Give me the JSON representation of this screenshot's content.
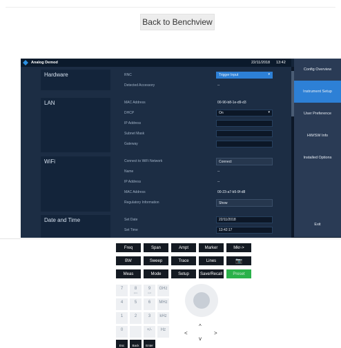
{
  "header": {
    "back_label": "Back to Benchview"
  },
  "titlebar": {
    "app": "Analog Demod",
    "date": "22/11/2018",
    "time": "13:42"
  },
  "sections": {
    "hardware": "Hardware",
    "lan": "LAN",
    "wifi": "WiFi",
    "datetime": "Date and Time"
  },
  "hardware": {
    "rnc_label": "RNC",
    "rnc_value": "Trigger Input",
    "accessory_label": "Detected Accessory",
    "accessory_value": "--"
  },
  "lan": {
    "mac_label": "MAC Address",
    "mac_value": "00-90-b8-1e-d9-d3",
    "dhcp_label": "DHCP",
    "dhcp_value": "On",
    "ip_label": "IP Address",
    "subnet_label": "Subnet Mask",
    "gateway_label": "Gateway"
  },
  "wifi": {
    "connect_label": "Connect to WiFi Network",
    "connect_button": "Connect",
    "name_label": "Name",
    "name_value": "--",
    "ip_label": "IP Address",
    "ip_value": "--",
    "mac_label": "MAC Address",
    "mac_value": "00-23-a7-b5-9f-d8",
    "regulatory_label": "Regulatory Information",
    "regulatory_button": "Show"
  },
  "datetime": {
    "date_label": "Set Date",
    "date_value": "22/11/2018",
    "time_label": "Set Time",
    "time_value": "13:42:17"
  },
  "softkeys": [
    {
      "label": "Config Overview"
    },
    {
      "label": "Instrument Setup"
    },
    {
      "label": "User Preference"
    },
    {
      "label": "HW/SW Info"
    },
    {
      "label": "Installed Options"
    },
    {
      "label": ""
    },
    {
      "label": ""
    },
    {
      "label": "Exit"
    }
  ],
  "keys": {
    "row1": [
      "Freq",
      "Span",
      "Ampt",
      "Marker",
      "Mkr->"
    ],
    "row2": [
      "BW",
      "Sweep",
      "Trace",
      "Lines",
      "📷"
    ],
    "row3": [
      "Meas",
      "Mode",
      "Setup",
      "Save/Recall",
      "Preset"
    ]
  },
  "numpad": {
    "digits": [
      "7",
      "8",
      "9",
      "4",
      "5",
      "6",
      "1",
      "2",
      "3",
      "0"
    ],
    "subs": [
      "",
      "pico",
      "cycl",
      "",
      "",
      "",
      "",
      "",
      "",
      ""
    ],
    "ghz": "GHz",
    "mhz": "MHz",
    "khz": "kHz",
    "hz": "Hz",
    "plusminus": "+/-",
    "esc": "Esc",
    "back": "Back",
    "enter": "Enter"
  },
  "colors": {
    "accent": "#2d80d6",
    "preset": "#2bb14a",
    "screen_bg": "#15253a"
  }
}
